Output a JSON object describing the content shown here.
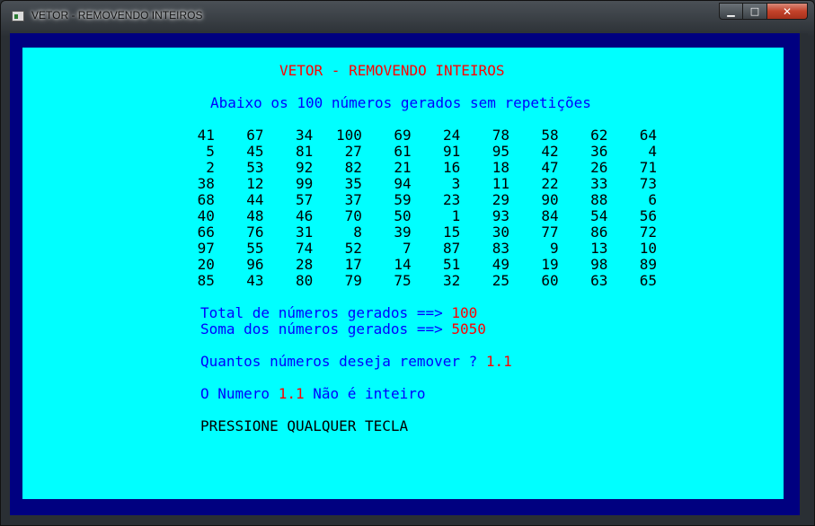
{
  "window": {
    "title": "VETOR - REMOVENDO INTEIROS",
    "controls": {
      "minimize": "▁",
      "maximize": "□",
      "close": "✕"
    }
  },
  "console": {
    "heading": "VETOR - REMOVENDO INTEIROS",
    "subheading": "Abaixo os 100 números gerados sem repetições",
    "numbers": [
      [
        "41",
        "67",
        "34",
        "100",
        "69",
        "24",
        "78",
        "58",
        "62",
        "64"
      ],
      [
        "5",
        "45",
        "81",
        "27",
        "61",
        "91",
        "95",
        "42",
        "36",
        "4"
      ],
      [
        "2",
        "53",
        "92",
        "82",
        "21",
        "16",
        "18",
        "47",
        "26",
        "71"
      ],
      [
        "38",
        "12",
        "99",
        "35",
        "94",
        "3",
        "11",
        "22",
        "33",
        "73"
      ],
      [
        "68",
        "44",
        "57",
        "37",
        "59",
        "23",
        "29",
        "90",
        "88",
        "6"
      ],
      [
        "40",
        "48",
        "46",
        "70",
        "50",
        "1",
        "93",
        "84",
        "54",
        "56"
      ],
      [
        "66",
        "76",
        "31",
        "8",
        "39",
        "15",
        "30",
        "77",
        "86",
        "72"
      ],
      [
        "97",
        "55",
        "74",
        "52",
        "7",
        "87",
        "83",
        "9",
        "13",
        "10"
      ],
      [
        "20",
        "96",
        "28",
        "17",
        "14",
        "51",
        "49",
        "19",
        "98",
        "89"
      ],
      [
        "85",
        "43",
        "80",
        "79",
        "75",
        "32",
        "25",
        "60",
        "63",
        "65"
      ]
    ],
    "total_label": "Total de números gerados ==> ",
    "total_value": "100",
    "sum_label": "Soma dos números gerados ==> ",
    "sum_value": "5050",
    "question_label": "Quantos números deseja remover ? ",
    "question_value": "1.1",
    "result_prefix": "O Numero ",
    "result_value": "1.1",
    "result_suffix": " Não é inteiro",
    "prompt": "PRESSIONE QUALQUER TECLA"
  },
  "colors": {
    "console_background": "#00ffff",
    "console_border": "#000080",
    "heading": "#ff0000",
    "label": "#0000ff",
    "value": "#ff0000",
    "numbers": "#000000"
  }
}
